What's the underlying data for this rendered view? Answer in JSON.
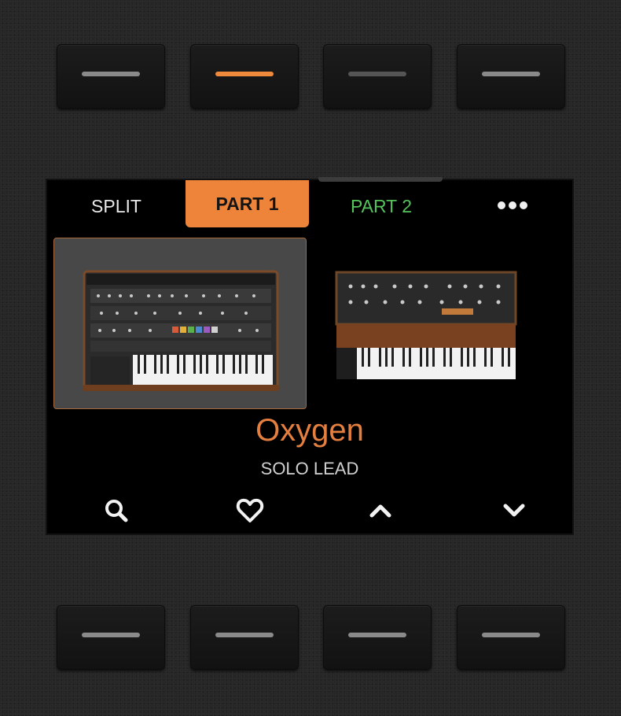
{
  "hardware": {
    "top_buttons": [
      {
        "led": "on"
      },
      {
        "led": "active"
      },
      {
        "led": "dim"
      },
      {
        "led": "on"
      }
    ],
    "bottom_buttons": [
      {
        "led": "on"
      },
      {
        "led": "on"
      },
      {
        "led": "on"
      },
      {
        "led": "on"
      }
    ]
  },
  "screen": {
    "tabs": [
      {
        "label": "SPLIT",
        "state": "inactive"
      },
      {
        "label": "PART 1",
        "state": "active"
      },
      {
        "label": "PART 2",
        "state": "inactive"
      }
    ],
    "more_icon": "ellipsis-icon",
    "instruments": [
      {
        "icon": "poly-synth-keyboard-image",
        "selected": true
      },
      {
        "icon": "mono-synth-keyboard-image",
        "selected": false
      }
    ],
    "patch": {
      "name": "Oxygen",
      "category": "SOLO LEAD"
    },
    "nav_icons": [
      "search-icon",
      "heart-icon",
      "chevron-up-icon",
      "chevron-down-icon"
    ]
  },
  "colors": {
    "accent": "#ee843a",
    "part2": "#55c25c",
    "patch_name": "#e47f3f"
  }
}
